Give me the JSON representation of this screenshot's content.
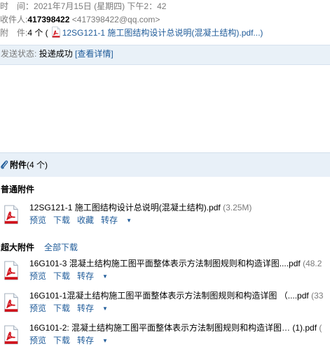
{
  "header": {
    "time_label": "时　间：",
    "time_value": "2021年7月15日 (星期四) 下午2：42",
    "to_label": "收件人:",
    "to_name": "417398422",
    "to_email": "<417398422@qq.com>",
    "att_label": "附　件:",
    "att_count": "4 个 (",
    "att_file": "12SG121-1 施工图结构设计总说明(混凝土结构).pdf...)"
  },
  "status": {
    "label": "发送状态:",
    "value": "投递成功",
    "link": "[查看详情]"
  },
  "attachments": {
    "title": "附件",
    "count": "(4 个)",
    "normal_section": "普通附件",
    "super_section": "超大附件",
    "download_all": "全部下载",
    "normal_files": [
      {
        "name": "12SG121-1 施工图结构设计总说明(混凝土结构).pdf",
        "size": "(3.25M)",
        "actions": [
          "预览",
          "下载",
          "收藏",
          "转存"
        ]
      }
    ],
    "super_files": [
      {
        "name": "16G101-3 混凝土结构施工图平面整体表示方法制图规则和构造详图....pdf",
        "size": "(48.2",
        "actions": [
          "预览",
          "下载",
          "转存"
        ]
      },
      {
        "name": "16G101-1混凝土结构施工图平面整体表示方法制图规则和构造详图 （....pdf",
        "size": "(33",
        "actions": [
          "预览",
          "下载",
          "转存"
        ]
      },
      {
        "name": "16G101-2: 混凝土结构施工图平面整体表示方法制图规则和构造详图… (1).pdf",
        "size": "(",
        "actions": [
          "预览",
          "下载",
          "转存"
        ]
      }
    ]
  },
  "colors": {
    "link": "#1f5b99",
    "muted": "#7a7a7a",
    "status_bg": "#e9f1f8",
    "pdf_red": "#d0121b"
  }
}
